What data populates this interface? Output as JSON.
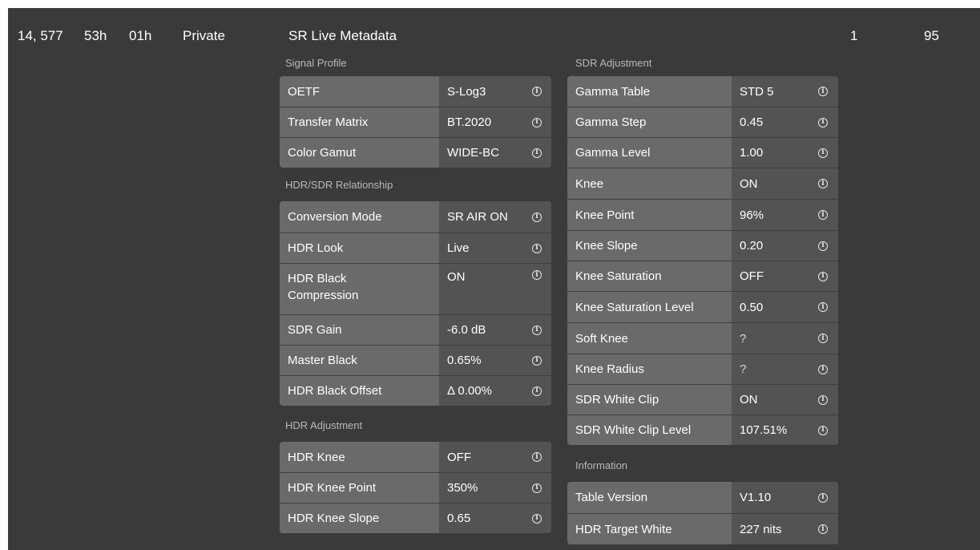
{
  "header": {
    "col1": "14, 577",
    "col2": "53h",
    "col3": "01h",
    "col4": "Private",
    "title": "SR Live Metadata",
    "col6": "1",
    "col7": "95"
  },
  "left": {
    "signal_profile": {
      "title": "Signal Profile",
      "rows": [
        {
          "label": "OETF",
          "value": "S-Log3"
        },
        {
          "label": "Transfer Matrix",
          "value": "BT.2020"
        },
        {
          "label": "Color Gamut",
          "value": "WIDE-BC"
        }
      ]
    },
    "hdr_sdr_relationship": {
      "title": "HDR/SDR Relationship",
      "rows": [
        {
          "label": "Conversion Mode",
          "value": "SR AIR ON"
        },
        {
          "label": "HDR Look",
          "value": "Live"
        },
        {
          "label": "HDR Black Compression",
          "value": "ON"
        },
        {
          "label": "SDR Gain",
          "value": "-6.0 dB"
        },
        {
          "label": "Master Black",
          "value": "0.65%"
        },
        {
          "label": "HDR Black Offset",
          "value": "Δ 0.00%"
        }
      ]
    },
    "hdr_adjustment": {
      "title": "HDR Adjustment",
      "rows": [
        {
          "label": "HDR Knee",
          "value": "OFF"
        },
        {
          "label": "HDR Knee Point",
          "value": "350%"
        },
        {
          "label": "HDR Knee Slope",
          "value": "0.65"
        }
      ]
    }
  },
  "right": {
    "sdr_adjustment": {
      "title": "SDR Adjustment",
      "rows": [
        {
          "label": "Gamma Table",
          "value": "STD 5"
        },
        {
          "label": "Gamma Step",
          "value": "0.45"
        },
        {
          "label": "Gamma Level",
          "value": "1.00"
        },
        {
          "label": "Knee",
          "value": "ON"
        },
        {
          "label": "Knee Point",
          "value": "96%"
        },
        {
          "label": "Knee Slope",
          "value": "0.20"
        },
        {
          "label": "Knee Saturation",
          "value": "OFF"
        },
        {
          "label": "Knee Saturation Level",
          "value": "0.50"
        },
        {
          "label": "Soft Knee",
          "value": "?"
        },
        {
          "label": "Knee Radius",
          "value": "?"
        },
        {
          "label": "SDR White Clip",
          "value": "ON"
        },
        {
          "label": "SDR White Clip Level",
          "value": "107.51%"
        }
      ]
    },
    "information": {
      "title": "Information",
      "rows": [
        {
          "label": "Table Version",
          "value": "V1.10"
        },
        {
          "label": "HDR Target White",
          "value": "227 nits"
        }
      ]
    }
  },
  "icons": {
    "info": "info-circle-icon",
    "info_glyph": "i"
  }
}
